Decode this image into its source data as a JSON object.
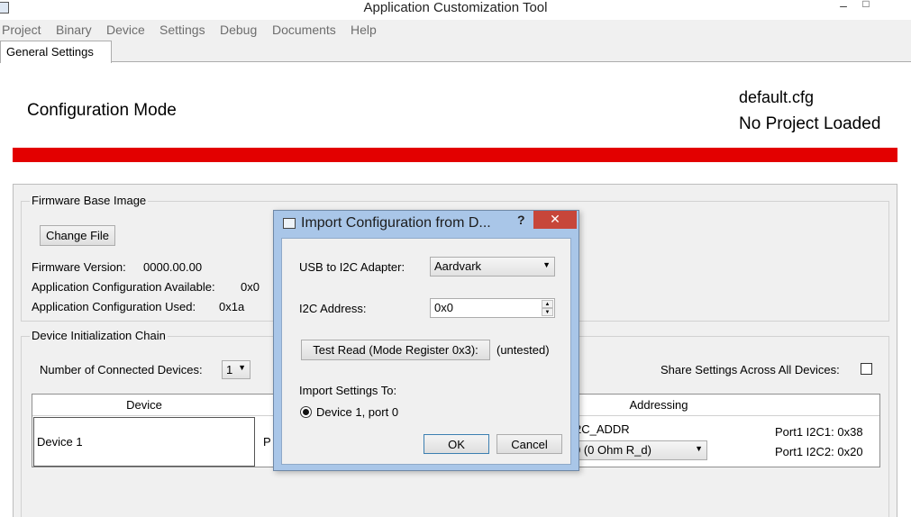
{
  "window": {
    "title": "Application Customization Tool",
    "minimize": "–",
    "maximize": "□"
  },
  "menu": [
    "Project",
    "Binary",
    "Device",
    "Settings",
    "Debug",
    "Documents",
    "Help"
  ],
  "tabs": [
    {
      "label": "General Settings"
    }
  ],
  "header": {
    "mode": "Configuration Mode",
    "config_file": "default.cfg",
    "project_status": "No Project Loaded"
  },
  "firmware": {
    "group_title": "Firmware Base Image",
    "change_file_label": "Change File",
    "version_label": "Firmware Version:",
    "version_value": "0000.00.00",
    "available_label": "Application Configuration Available:",
    "available_value": "0x0",
    "used_label": "Application Configuration Used:",
    "used_value": "0x1a"
  },
  "chain": {
    "group_title": "Device Initialization Chain",
    "count_label": "Number of Connected Devices:",
    "count_value": "1",
    "share_label": "Share Settings Across All Devices:",
    "columns": {
      "device": "Device",
      "addressing": "Addressing"
    },
    "rows": [
      {
        "device": "Device 1",
        "port_partial": "P",
        "addr_partial": "2C_ADDR",
        "addr_select": "0 (0 Ohm R_d)",
        "port1_i2c1": "Port1 I2C1: 0x38",
        "port1_i2c2": "Port1 I2C2: 0x20"
      }
    ]
  },
  "dialog": {
    "title": "Import Configuration from D...",
    "help": "?",
    "close": "✕",
    "adapter_label": "USB to I2C Adapter:",
    "adapter_value": "Aardvark",
    "address_label": "I2C Address:",
    "address_value": "0x0",
    "test_read_label": "Test Read (Mode Register 0x3):",
    "test_status": "(untested)",
    "import_to_label": "Import Settings To:",
    "import_option": "Device 1, port 0",
    "ok_label": "OK",
    "cancel_label": "Cancel"
  }
}
